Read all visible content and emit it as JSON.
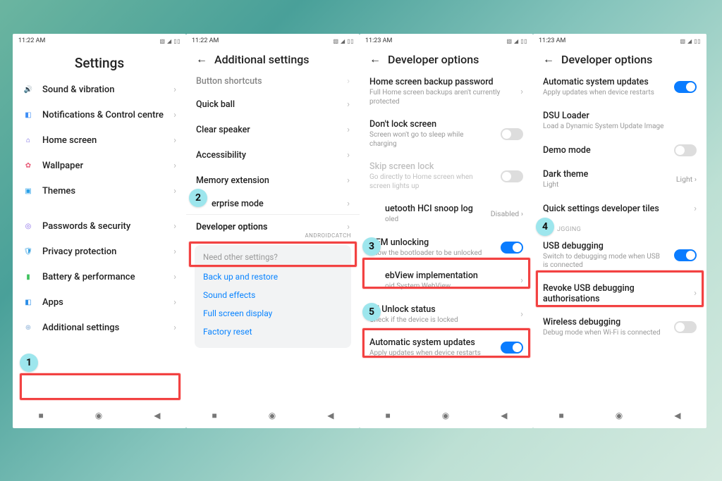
{
  "status": {
    "time1": "11:22 AM",
    "time2": "11:22 AM",
    "time3": "11:23 AM",
    "time4": "11:23 AM",
    "icons": "▧ ◢ ▯▯"
  },
  "watermark": "ANDROIDCATCH",
  "p1": {
    "title": "Settings",
    "items": [
      {
        "icon": "🔊",
        "color": "#58c36a",
        "label": "Sound & vibration"
      },
      {
        "icon": "◧",
        "color": "#3d8df5",
        "label": "Notifications & Control centre"
      },
      {
        "icon": "⌂",
        "color": "#6a5ae0",
        "label": "Home screen"
      },
      {
        "icon": "✿",
        "color": "#e85a77",
        "label": "Wallpaper"
      },
      {
        "icon": "▣",
        "color": "#2aa0e8",
        "label": "Themes"
      },
      {
        "icon": "◎",
        "color": "#8a6de8",
        "label": "Passwords & security"
      },
      {
        "icon": "🛡",
        "color": "#2a9be0",
        "label": "Privacy protection"
      },
      {
        "icon": "▮",
        "color": "#3fc25e",
        "label": "Battery & performance"
      },
      {
        "icon": "◧",
        "color": "#2a8de8",
        "label": "Apps"
      },
      {
        "icon": "⊕",
        "color": "#8fb3d9",
        "label": "Additional settings"
      }
    ]
  },
  "p2": {
    "title": "Additional settings",
    "top_cut": "Button shortcuts",
    "items": [
      "Quick ball",
      "Clear speaker",
      "Accessibility",
      "Memory extension"
    ],
    "enterprise_partial": "erprise mode",
    "dev": "Developer options",
    "suggest_title": "Need other settings?",
    "suggest": [
      "Back up and restore",
      "Sound effects",
      "Full screen display",
      "Factory reset"
    ]
  },
  "p3": {
    "title": "Developer options",
    "items": [
      {
        "label": "Home screen backup password",
        "sub": "Full Home screen backups aren't currently protected",
        "type": "chev"
      },
      {
        "label": "Don't lock screen",
        "sub": "Screen won't go to sleep while charging",
        "type": "toggle",
        "on": false
      },
      {
        "label": "Skip screen lock",
        "sub": "Go directly to Home screen when screen lights up",
        "type": "toggle",
        "on": false,
        "disabled": true
      },
      {
        "label": "Bluetooth HCI snoop log",
        "sub": "",
        "type": "value",
        "value": "Disabled",
        "partial_label": "uetooth HCI snoop log",
        "partial_sub": "oled"
      },
      {
        "label": "OEM unlocking",
        "sub": "Allow the bootloader to be unlocked",
        "type": "toggle",
        "on": true
      },
      {
        "label": "WebView implementation",
        "sub": "Android System WebView",
        "type": "chev",
        "partial_label": "ebView implementation",
        "partial_sub": "oid System WebView"
      },
      {
        "label": "Mi Unlock status",
        "sub": "Check if the device is locked",
        "type": "chev"
      },
      {
        "label": "Automatic system updates",
        "sub": "Apply updates when device restarts",
        "type": "toggle",
        "on": true
      }
    ]
  },
  "p4": {
    "title": "Developer options",
    "top": [
      {
        "label": "Automatic system updates",
        "sub": "Apply updates when device restarts",
        "type": "toggle",
        "on": true
      },
      {
        "label": "DSU Loader",
        "sub": "Load a Dynamic System Update Image",
        "type": "none"
      },
      {
        "label": "Demo mode",
        "sub": "",
        "type": "toggle",
        "on": false
      },
      {
        "label": "Dark theme",
        "sub": "Light",
        "type": "value",
        "value": "Light"
      },
      {
        "label": "Quick settings developer tiles",
        "sub": "",
        "type": "chev"
      }
    ],
    "section": "DEBUGGING",
    "section_partial": "JGGING",
    "bottom": [
      {
        "label": "USB debugging",
        "sub": "Switch to debugging mode when USB is connected",
        "type": "toggle",
        "on": true
      },
      {
        "label": "Revoke USB debugging authorisations",
        "sub": "",
        "type": "chev"
      },
      {
        "label": "Wireless debugging",
        "sub": "Debug mode when Wi-Fi is connected",
        "type": "toggle",
        "on": false
      }
    ]
  },
  "steps": {
    "s1": "1",
    "s2": "2",
    "s3": "3",
    "s4": "4",
    "s5": "5"
  },
  "nav": {
    "square": "■",
    "circle": "◉",
    "tri": "◀"
  }
}
